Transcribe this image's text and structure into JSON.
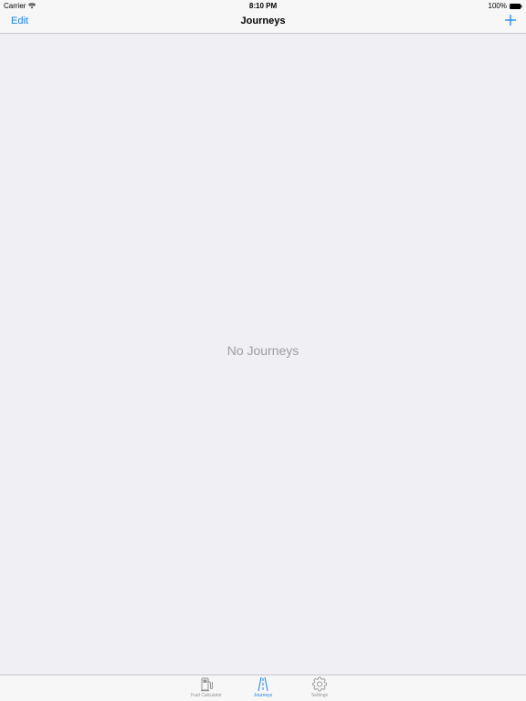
{
  "status_bar": {
    "carrier": "Carrier",
    "time": "8:10 PM",
    "battery": "100%"
  },
  "nav": {
    "edit_label": "Edit",
    "title": "Journeys",
    "add_icon": "plus-icon"
  },
  "content": {
    "empty_text": "No Journeys"
  },
  "tabs": [
    {
      "label": "Fuel Calculator",
      "icon": "fuel-pump-icon",
      "active": false
    },
    {
      "label": "Journeys",
      "icon": "road-icon",
      "active": true
    },
    {
      "label": "Settings",
      "icon": "gear-icon",
      "active": false
    }
  ],
  "colors": {
    "accent": "#1a82fb",
    "background": "#efeff4",
    "bar": "#f7f7f7",
    "inactive": "#929292",
    "empty_text": "#9d9da2"
  }
}
